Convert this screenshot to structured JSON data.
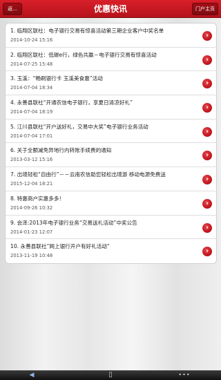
{
  "header": {
    "back_label": "返...",
    "title": "优惠快讯",
    "home_label": "门户主页"
  },
  "items": [
    {
      "title": "1. 临翔区联社：电子银行交易有惊喜活动第三期企业客户中奖名单",
      "date": "2014-10-24 15:16"
    },
    {
      "title": "2. 临翔区联社：低碳e行，绿色共赢－电子银行交易有惊喜活动",
      "date": "2014-07-25 15:48"
    },
    {
      "title": "3. 玉溪：“畅刷银行卡 玉溪美食惠”活动",
      "date": "2014-07-04 18:34"
    },
    {
      "title": "4. 永善县联社“开通农信电子银行，享夏日清凉好礼”",
      "date": "2014-07-04 18:19"
    },
    {
      "title": "5. 江川县联社“开户送好礼，交易中大奖”电子银行业务活动",
      "date": "2014-07-04 17:01"
    },
    {
      "title": "6. 关于全额减免异地行内转账手续费的通知",
      "date": "2013-03-12 15:16"
    },
    {
      "title": "7. 出境轻松“自由行”－－云南农信助您轻松出境游 移动电源免费送",
      "date": "2015-12-04 18:21"
    },
    {
      "title": "8. 特惠商户实惠多多！",
      "date": "2014-09-26 10:32"
    },
    {
      "title": "9. 会泽:2013年电子银行业务“交易送礼活动”中奖公告",
      "date": "2014-01-23 12:07"
    },
    {
      "title": "10. 永善县联社”网上银行开户有好礼活动”",
      "date": "2013-11-19 10:48"
    }
  ],
  "icons": {
    "arrow": "chevron-right-icon",
    "nav_back": "back-icon",
    "nav_home": "home-icon",
    "nav_menu": "more-icon"
  },
  "colors": {
    "header": "#c41820",
    "accent": "#d8202a"
  }
}
